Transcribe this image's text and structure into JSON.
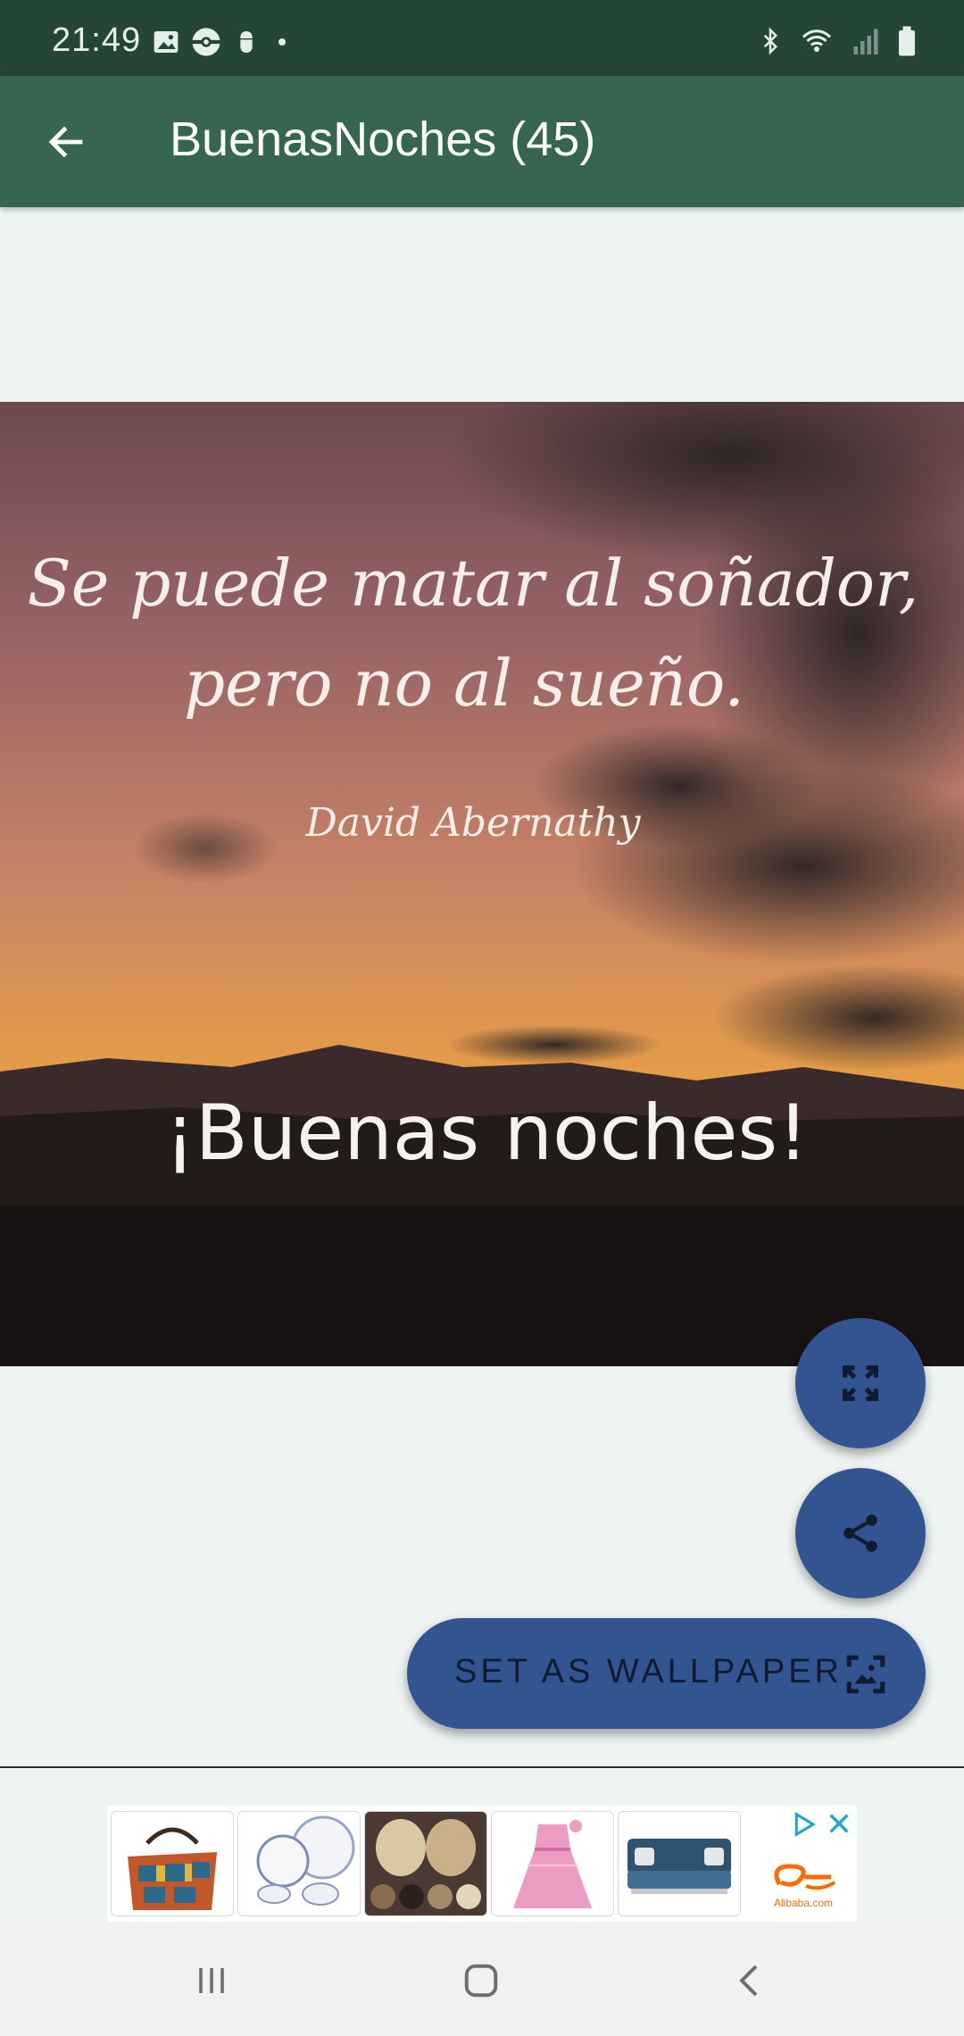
{
  "status_bar": {
    "time": "21:49",
    "left_icons": [
      "image-icon",
      "pokeball-icon",
      "android-debug-icon",
      "dot-icon"
    ],
    "right_icons": [
      "bluetooth-icon",
      "wifi-icon",
      "signal-icon",
      "battery-icon"
    ]
  },
  "app_bar": {
    "title": "BuenasNoches (45)",
    "back_icon": "arrow-left-icon",
    "color": "#366650"
  },
  "image": {
    "quote_line1": "Se puede matar al soñador,",
    "quote_line2": "pero no al sueño.",
    "author": "David Abernathy",
    "greeting": "¡Buenas noches!"
  },
  "actions": {
    "expand_icon": "fullscreen-icon",
    "share_icon": "share-icon",
    "wallpaper_label": "SET AS WALLPAPER",
    "wallpaper_icon": "wallpaper-icon",
    "accent": "#325591"
  },
  "ad": {
    "products": [
      "patchwork-handbag",
      "porcelain-dinnerware-set",
      "short-hairstyles",
      "pink-girls-dress",
      "blue-sofa-bed"
    ],
    "brand": "Alibaba.com",
    "adchoices_icon": "adchoices-icon",
    "close_icon": "close-icon"
  },
  "nav_bar": {
    "items": [
      "recents-icon",
      "home-icon",
      "back-icon"
    ]
  }
}
